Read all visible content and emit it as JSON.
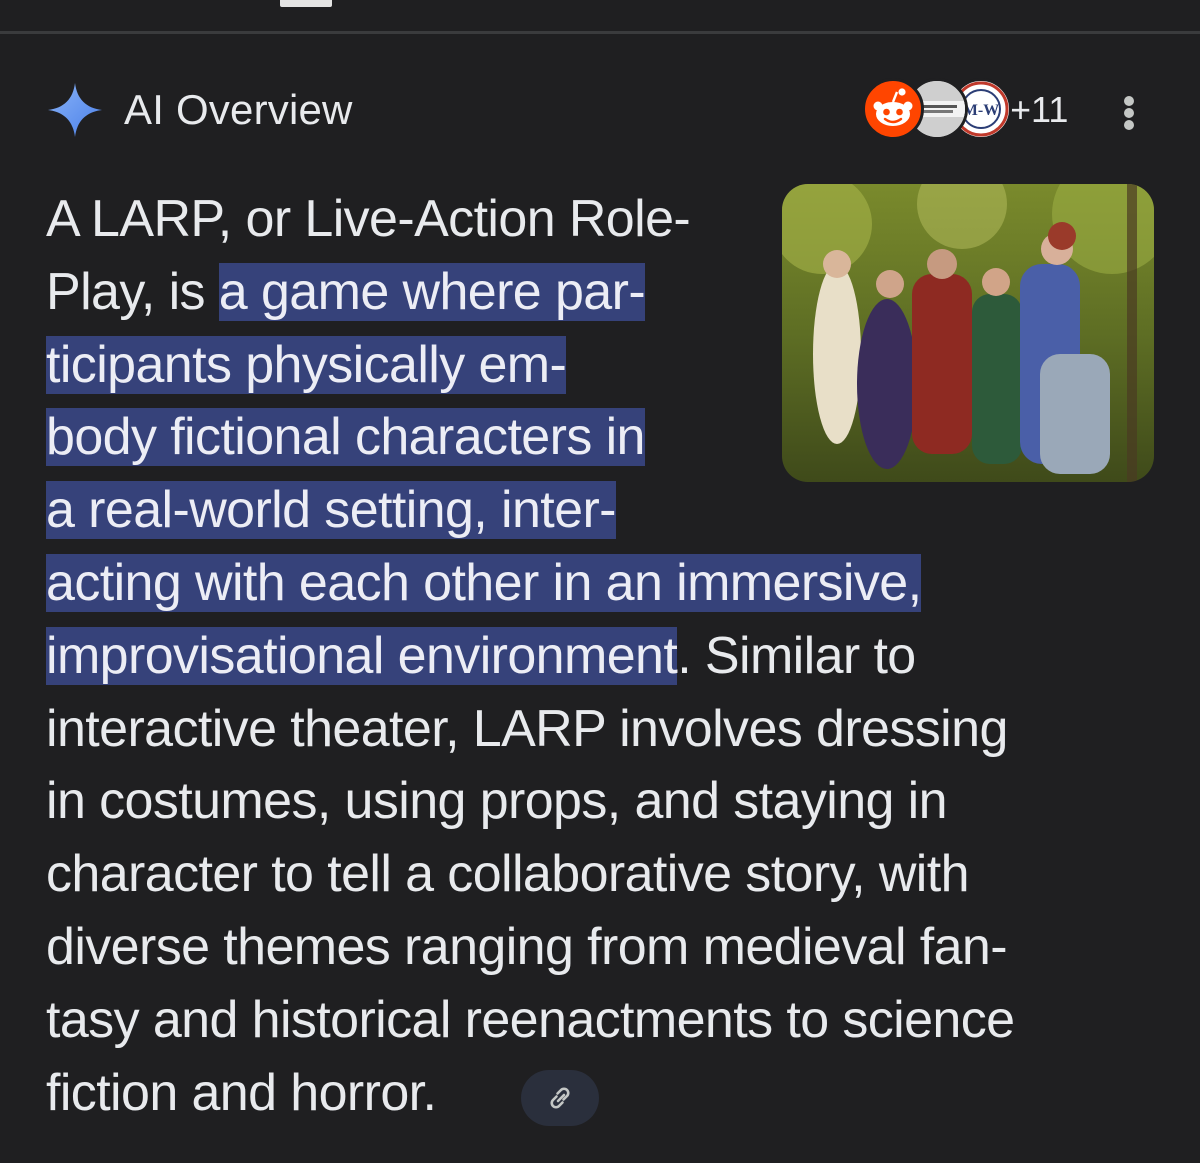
{
  "header": {
    "title": "AI Overview",
    "more_sources": "+11",
    "sources": [
      {
        "icon": "reddit-icon",
        "color": "#ff4500"
      },
      {
        "icon": "book-source-icon",
        "color": "#d6d6d6"
      },
      {
        "icon": "merriam-webster-icon",
        "color": "#ffffff",
        "text": "M-W"
      }
    ]
  },
  "answer": {
    "lines": [
      "A LARP, or Live-Action Role-",
      "Play, is ",
      "a game where par-",
      "ticipants physically em-",
      "body fictional characters in",
      "a real-world setting, inter-",
      "acting with each other in an immersive,",
      "improvisational environment",
      ". Similar to",
      "interactive theater, LARP involves dressing",
      "in costumes, using props, and staying in",
      "character to tell a collaborative story, with",
      "diverse themes ranging from medieval fan-",
      "tasy and historical reenactments to science",
      "fiction and horror."
    ]
  },
  "colors": {
    "background": "#1f1f21",
    "highlight": "#36427a",
    "text": "#e8eaed",
    "sparkle": "#6fa8ff"
  }
}
